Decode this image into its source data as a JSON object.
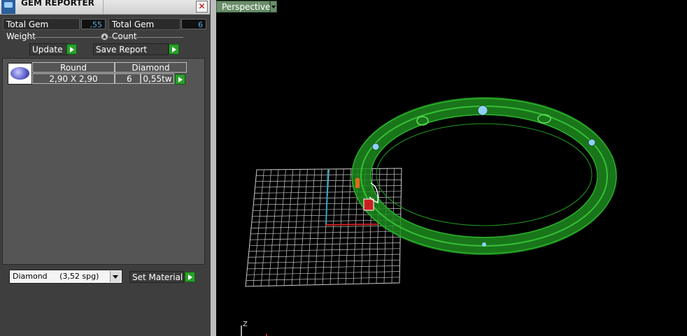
{
  "panel": {
    "title": "GEM REPORTER",
    "close_glyph": "✕",
    "total_weight_label": "Total Gem Weight",
    "total_weight_value": ",55",
    "total_count_label": "Total Gem Count",
    "total_count_value": "6",
    "update_label": "Update",
    "save_report_label": "Save Report"
  },
  "gem_table": {
    "columns": [
      "Round",
      "Diamond"
    ],
    "row": {
      "size": "2,90 X 2,90",
      "count": "6",
      "weight": "0,55tw"
    }
  },
  "material": {
    "selected": "Diamond     (3,52 spg)",
    "set_label": "Set Material"
  },
  "viewport": {
    "view_mode": "Perspective",
    "axis_label": "Z"
  },
  "colors": {
    "accent_green": "#2aa02a",
    "ring_green": "#22a022",
    "grid": "#c8c8c8"
  }
}
